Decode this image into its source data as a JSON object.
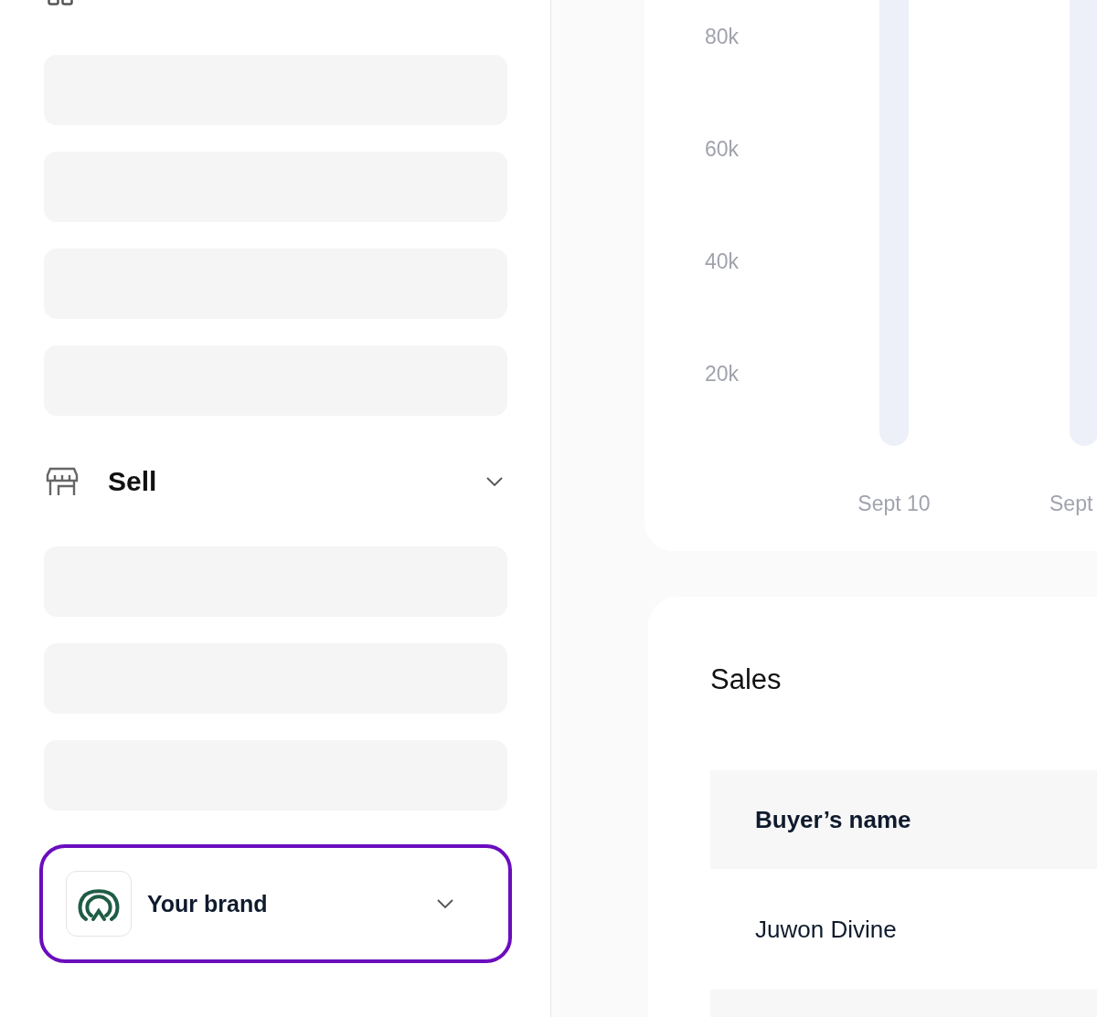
{
  "sidebar": {
    "items": [
      {
        "kind": "skeleton"
      },
      {
        "kind": "skeleton"
      },
      {
        "kind": "skeleton"
      },
      {
        "kind": "skeleton"
      },
      {
        "kind": "section",
        "label": "Sell"
      },
      {
        "kind": "skeleton"
      },
      {
        "kind": "skeleton"
      },
      {
        "kind": "skeleton"
      }
    ],
    "brand_switcher": {
      "label": "Your brand",
      "focused": true
    }
  },
  "chart": {
    "y_labels": [
      "80k",
      "60k",
      "40k",
      "20k"
    ],
    "x_labels": [
      "Sept 10",
      "Sept"
    ]
  },
  "sales": {
    "title": "Sales",
    "table": {
      "columns": [
        "Buyer’s name"
      ],
      "rows": [
        [
          "Juwon Divine"
        ]
      ]
    }
  }
}
